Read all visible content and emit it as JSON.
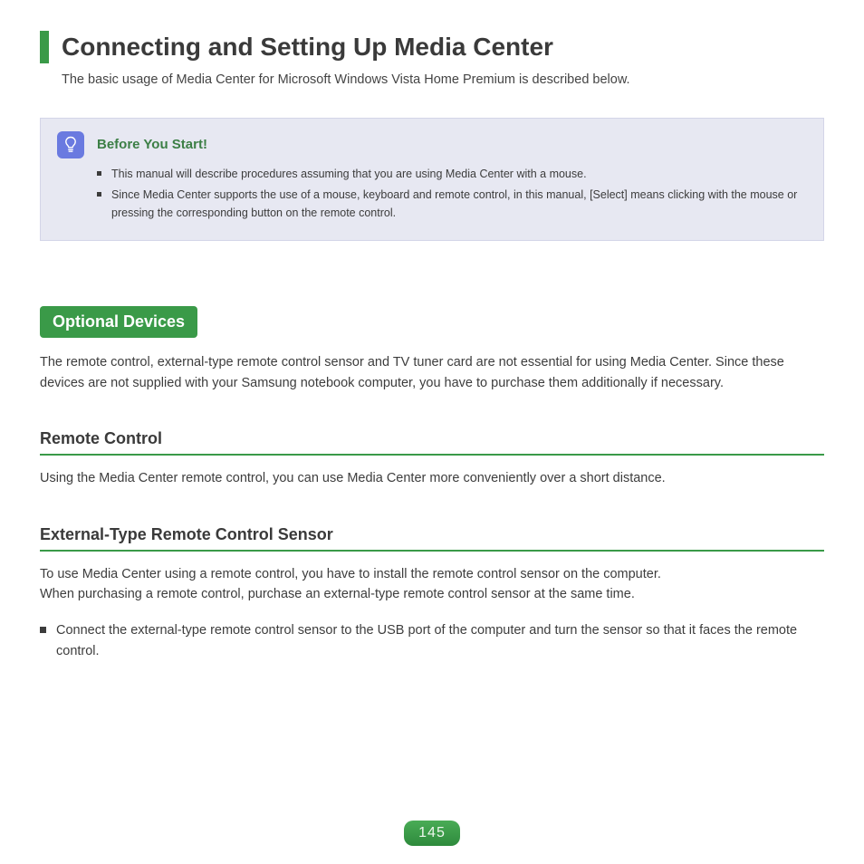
{
  "header": {
    "title": "Connecting and Setting Up Media Center",
    "intro": "The basic usage of Media Center for Microsoft Windows Vista Home Premium is described below."
  },
  "tip": {
    "title": "Before You Start!",
    "items": [
      "This manual will describe procedures assuming that you are using Media Center with a mouse.",
      "Since Media Center supports the use of a mouse, keyboard and remote control, in this manual, [Select] means clicking with the mouse or pressing the corresponding button on the remote control."
    ]
  },
  "section": {
    "tag": "Optional Devices",
    "body": "The remote control, external-type remote control sensor and TV tuner card are not essential for using Media Center. Since these devices are not supplied with your Samsung notebook computer, you have to purchase them additionally if necessary."
  },
  "sub1": {
    "head": "Remote Control",
    "body": "Using the Media Center remote control, you can use Media Center more conveniently over a short distance."
  },
  "sub2": {
    "head": "External-Type Remote Control Sensor",
    "body": "To use Media Center using a remote control, you have to install the remote control sensor on the computer.\nWhen purchasing a remote control, purchase an external-type remote control sensor at the same time.",
    "bullets": [
      "Connect the external-type remote control sensor to the USB port of the computer and turn the sensor so that it faces the remote control."
    ]
  },
  "page_number": "145"
}
